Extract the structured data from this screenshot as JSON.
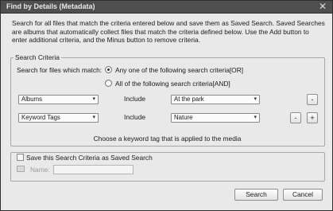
{
  "window": {
    "title": "Find by Details (Metadata)",
    "close_glyph": "✕"
  },
  "description": "Search for all files that match the criteria entered below and save them as Saved Search. Saved Searches are albums that automatically collect files that match the criteria defined below. Use the Add button to enter additional criteria, and the Minus button to remove criteria.",
  "criteria": {
    "legend": "Search Criteria",
    "match_label": "Search for files which match:",
    "match_any_label": "Any one of the following search criteria[OR]",
    "match_all_label": "All of the following search criteria[AND]",
    "selected_match": "any",
    "rows": [
      {
        "attribute": "Albums",
        "operator": "Include",
        "value": "At the park"
      },
      {
        "attribute": "Keyword Tags",
        "operator": "Include",
        "value": "Nature"
      }
    ],
    "remove_glyph": "-",
    "add_glyph": "+",
    "hint": "Choose a keyword tag that is applied to the media"
  },
  "saved_search": {
    "checkbox_label": "Save this Search Criteria as Saved Search",
    "checked": false,
    "name_label": "Name:",
    "name_value": ""
  },
  "buttons": {
    "search": "Search",
    "cancel": "Cancel"
  },
  "icons": {
    "caret": "▾"
  },
  "colors": {
    "titlebar": "#4f4f4f",
    "dialog_bg": "#e9e9e9"
  }
}
